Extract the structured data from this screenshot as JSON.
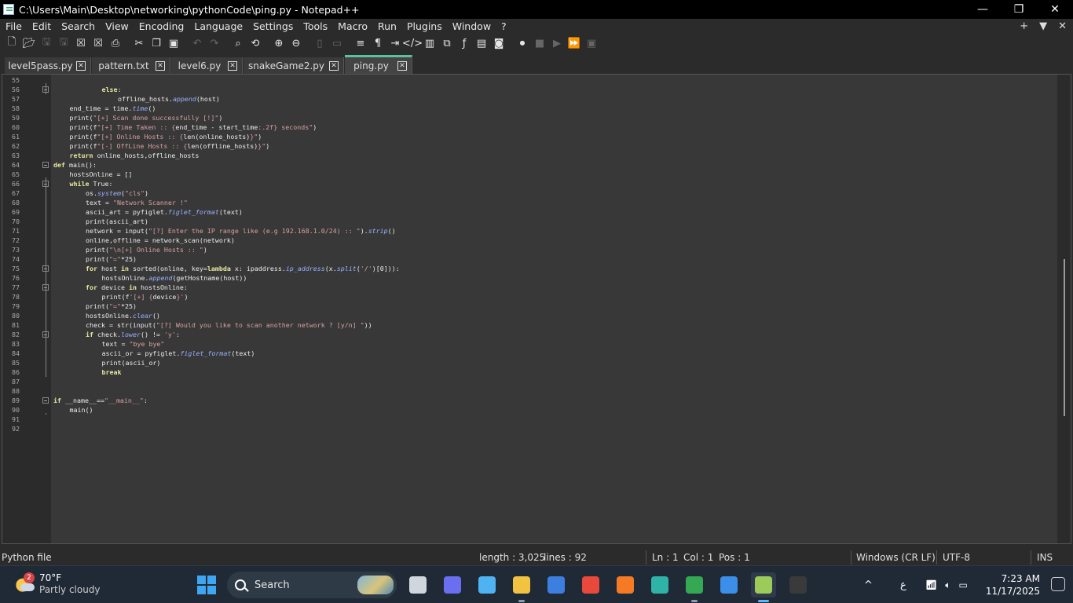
{
  "window": {
    "title": "C:\\Users\\Main\\Desktop\\networking\\pythonCode\\ping.py - Notepad++",
    "controls": [
      "—",
      "❐",
      "✕"
    ]
  },
  "menu": {
    "items": [
      "File",
      "Edit",
      "Search",
      "View",
      "Encoding",
      "Language",
      "Settings",
      "Tools",
      "Macro",
      "Run",
      "Plugins",
      "Window",
      "?"
    ],
    "right": [
      "+",
      "▼",
      "✕"
    ]
  },
  "toolbar": {
    "icons": [
      "new-file-icon",
      "open-file-icon",
      "save-icon",
      "save-all-icon",
      "close-icon",
      "close-all-icon",
      "print-icon",
      "cut-icon",
      "copy-icon",
      "paste-icon",
      "undo-icon",
      "redo-icon",
      "find-icon",
      "replace-icon",
      "zoom-in-icon",
      "zoom-out-icon",
      "sync-vertical-icon",
      "sync-horizontal-icon",
      "word-wrap-icon",
      "show-all-chars-icon",
      "indent-guide-icon",
      "xml-tag-icon",
      "doc-map-icon",
      "doc-list-icon",
      "function-list-icon",
      "folder-workspace-icon",
      "monitor-icon",
      "record-macro-icon",
      "stop-record-icon",
      "play-macro-icon",
      "run-macro-multiple-icon",
      "save-macro-icon"
    ]
  },
  "tabs": [
    {
      "label": "level5pass.py",
      "active": false
    },
    {
      "label": "pattern.txt",
      "active": false
    },
    {
      "label": "level6.py",
      "active": false
    },
    {
      "label": "snakeGame2.py",
      "active": false
    },
    {
      "label": "ping.py",
      "active": true
    }
  ],
  "editor": {
    "lines": [
      {
        "n": "55",
        "indent": 0,
        "tokens": []
      },
      {
        "n": "56",
        "indent": 3,
        "tokens": [
          [
            "kw",
            "else"
          ],
          [
            "plain",
            ":"
          ]
        ]
      },
      {
        "n": "57",
        "indent": 4,
        "tokens": [
          [
            "plain",
            "offline_hosts."
          ],
          [
            "fn",
            "append"
          ],
          [
            "plain",
            "(host)"
          ]
        ]
      },
      {
        "n": "58",
        "indent": 1,
        "tokens": [
          [
            "plain",
            "end_time = time."
          ],
          [
            "fn",
            "time"
          ],
          [
            "plain",
            "()"
          ]
        ]
      },
      {
        "n": "59",
        "indent": 1,
        "tokens": [
          [
            "plain",
            "print("
          ],
          [
            "str",
            "\"[+] Scan done successfully [!]\""
          ],
          [
            "plain",
            ")"
          ]
        ]
      },
      {
        "n": "60",
        "indent": 1,
        "tokens": [
          [
            "plain",
            "print(f"
          ],
          [
            "str",
            "\"[+] Time Taken :: {"
          ],
          [
            "plain",
            "end_time - start_time"
          ],
          [
            "str",
            ":.2f} seconds\""
          ],
          [
            "plain",
            ")"
          ]
        ]
      },
      {
        "n": "61",
        "indent": 1,
        "tokens": [
          [
            "plain",
            "print(f"
          ],
          [
            "str",
            "\"[+] Online Hosts :: {"
          ],
          [
            "plain",
            "len(online_hosts)"
          ],
          [
            "str",
            "}\""
          ],
          [
            "plain",
            ")"
          ]
        ]
      },
      {
        "n": "62",
        "indent": 1,
        "tokens": [
          [
            "plain",
            "print(f"
          ],
          [
            "str",
            "\"[-] OffLine Hosts :: {"
          ],
          [
            "plain",
            "len(offline_hosts)"
          ],
          [
            "str",
            "}\""
          ],
          [
            "plain",
            ")"
          ]
        ]
      },
      {
        "n": "63",
        "indent": 1,
        "tokens": [
          [
            "kw",
            "return"
          ],
          [
            "plain",
            " online_hosts,offline_hosts"
          ]
        ]
      },
      {
        "n": "64",
        "indent": 0,
        "tokens": [
          [
            "kw",
            "def"
          ],
          [
            "plain",
            " main():"
          ]
        ]
      },
      {
        "n": "65",
        "indent": 1,
        "tokens": [
          [
            "plain",
            "hostsOnline = []"
          ]
        ]
      },
      {
        "n": "66",
        "indent": 1,
        "tokens": [
          [
            "kw",
            "while"
          ],
          [
            "plain",
            " True:"
          ]
        ]
      },
      {
        "n": "67",
        "indent": 2,
        "tokens": [
          [
            "plain",
            "os."
          ],
          [
            "fn",
            "system"
          ],
          [
            "plain",
            "("
          ],
          [
            "str",
            "\"cls\""
          ],
          [
            "plain",
            ")"
          ]
        ]
      },
      {
        "n": "68",
        "indent": 2,
        "tokens": [
          [
            "plain",
            "text = "
          ],
          [
            "str",
            "\"Network Scanner !\""
          ]
        ]
      },
      {
        "n": "69",
        "indent": 2,
        "tokens": [
          [
            "plain",
            "ascii_art = pyfiglet."
          ],
          [
            "fn",
            "figlet_format"
          ],
          [
            "plain",
            "(text)"
          ]
        ]
      },
      {
        "n": "70",
        "indent": 2,
        "tokens": [
          [
            "plain",
            "print(ascii_art)"
          ]
        ]
      },
      {
        "n": "71",
        "indent": 2,
        "tokens": [
          [
            "plain",
            "network = input("
          ],
          [
            "str",
            "\"[?] Enter the IP range like (e.g 192.168.1.0/24) :: \""
          ],
          [
            "plain",
            ")."
          ],
          [
            "fn",
            "strip"
          ],
          [
            "plain",
            "()"
          ]
        ]
      },
      {
        "n": "72",
        "indent": 2,
        "tokens": [
          [
            "plain",
            "online,offline = network_scan(network)"
          ]
        ]
      },
      {
        "n": "73",
        "indent": 2,
        "tokens": [
          [
            "plain",
            "print("
          ],
          [
            "str",
            "\"\\n[+] Online Hosts :: \""
          ],
          [
            "plain",
            ")"
          ]
        ]
      },
      {
        "n": "74",
        "indent": 2,
        "tokens": [
          [
            "plain",
            "print("
          ],
          [
            "str",
            "\"=\""
          ],
          [
            "plain",
            "*25)"
          ]
        ]
      },
      {
        "n": "75",
        "indent": 2,
        "tokens": [
          [
            "kw",
            "for"
          ],
          [
            "plain",
            " host "
          ],
          [
            "kw",
            "in"
          ],
          [
            "plain",
            " sorted(online, key="
          ],
          [
            "kw",
            "lambda"
          ],
          [
            "plain",
            " x: ipaddress."
          ],
          [
            "fn",
            "ip_address"
          ],
          [
            "plain",
            "(x."
          ],
          [
            "fn",
            "split"
          ],
          [
            "plain",
            "("
          ],
          [
            "str",
            "'/'"
          ],
          [
            "plain",
            ")[0])):"
          ]
        ]
      },
      {
        "n": "76",
        "indent": 3,
        "tokens": [
          [
            "plain",
            "hostsOnline."
          ],
          [
            "fn",
            "append"
          ],
          [
            "plain",
            "(getHostname(host))"
          ]
        ]
      },
      {
        "n": "77",
        "indent": 2,
        "tokens": [
          [
            "kw",
            "for"
          ],
          [
            "plain",
            " device "
          ],
          [
            "kw",
            "in"
          ],
          [
            "plain",
            " hostsOnline:"
          ]
        ]
      },
      {
        "n": "78",
        "indent": 3,
        "tokens": [
          [
            "plain",
            "print(f"
          ],
          [
            "str",
            "'[+] {"
          ],
          [
            "plain",
            "device"
          ],
          [
            "str",
            "}'"
          ],
          [
            "plain",
            ")"
          ]
        ]
      },
      {
        "n": "79",
        "indent": 2,
        "tokens": [
          [
            "plain",
            "print("
          ],
          [
            "str",
            "\"=\""
          ],
          [
            "plain",
            "*25)"
          ]
        ]
      },
      {
        "n": "80",
        "indent": 2,
        "tokens": [
          [
            "plain",
            "hostsOnline."
          ],
          [
            "fn",
            "clear"
          ],
          [
            "plain",
            "()"
          ]
        ]
      },
      {
        "n": "81",
        "indent": 2,
        "tokens": [
          [
            "plain",
            "check = str(input("
          ],
          [
            "str",
            "\"[?] Would you like to scan another network ? [y/n] \""
          ],
          [
            "plain",
            "))"
          ]
        ]
      },
      {
        "n": "82",
        "indent": 2,
        "tokens": [
          [
            "kw",
            "if"
          ],
          [
            "plain",
            " check."
          ],
          [
            "fn",
            "lower"
          ],
          [
            "plain",
            "() != "
          ],
          [
            "str",
            "'y'"
          ],
          [
            "plain",
            ":"
          ]
        ]
      },
      {
        "n": "83",
        "indent": 3,
        "tokens": [
          [
            "plain",
            "text = "
          ],
          [
            "str",
            "\"bye bye\""
          ]
        ]
      },
      {
        "n": "84",
        "indent": 3,
        "tokens": [
          [
            "plain",
            "ascii_or = pyfiglet."
          ],
          [
            "fn",
            "figlet_format"
          ],
          [
            "plain",
            "(text)"
          ]
        ]
      },
      {
        "n": "85",
        "indent": 3,
        "tokens": [
          [
            "plain",
            "print(ascii_or)"
          ]
        ]
      },
      {
        "n": "86",
        "indent": 3,
        "tokens": [
          [
            "kw",
            "break"
          ]
        ]
      },
      {
        "n": "87",
        "indent": 0,
        "tokens": []
      },
      {
        "n": "88",
        "indent": 0,
        "tokens": []
      },
      {
        "n": "89",
        "indent": 0,
        "tokens": [
          [
            "kw",
            "if"
          ],
          [
            "plain",
            " __name__=="
          ],
          [
            "str",
            "\"__main__\""
          ],
          [
            "plain",
            ":"
          ]
        ]
      },
      {
        "n": "90",
        "indent": 1,
        "tokens": [
          [
            "plain",
            "main()"
          ]
        ]
      },
      {
        "n": "91",
        "indent": 0,
        "tokens": []
      },
      {
        "n": "92",
        "indent": 0,
        "tokens": []
      }
    ],
    "fold_lines": [
      "56",
      "64",
      "66",
      "75",
      "77",
      "82",
      "89"
    ]
  },
  "statusbar": {
    "file_type": "Python file",
    "length": "length : 3,025",
    "lines": "lines : 92",
    "ln": "Ln : 1",
    "col": "Col : 1",
    "pos": "Pos : 1",
    "eol": "Windows (CR LF)",
    "encoding": "UTF-8",
    "mode": "INS"
  },
  "taskbar": {
    "weather_badge": "2",
    "temperature": "70°F",
    "condition": "Partly cloudy",
    "search_placeholder": "Search",
    "apps": [
      {
        "name": "task-view-icon",
        "color": "#d0d6de",
        "active": false
      },
      {
        "name": "teams-chat-icon",
        "color": "#6a6ff0",
        "active": false
      },
      {
        "name": "copilot-icon",
        "color": "#4fb3f2",
        "active": false
      },
      {
        "name": "file-explorer-icon",
        "color": "#f2c241",
        "active": false
      },
      {
        "name": "store-icon",
        "color": "#3c7fe0",
        "active": false
      },
      {
        "name": "chrome-icon",
        "color": "#e9493a",
        "active": false
      },
      {
        "name": "firefox-icon",
        "color": "#f47b24",
        "active": false
      },
      {
        "name": "edge-icon",
        "color": "#2fb3a6",
        "active": false
      },
      {
        "name": "chrome-profile-icon",
        "color": "#34a853",
        "active": false
      },
      {
        "name": "photos-icon",
        "color": "#3b8fe8",
        "active": false
      },
      {
        "name": "notepadpp-icon",
        "color": "#9ccb5a",
        "active": true
      },
      {
        "name": "terminal-icon",
        "color": "#3a3a3a",
        "active": false
      }
    ],
    "tray": {
      "chevron": "^",
      "language": "ع",
      "time": "7:23 AM",
      "date": "11/17/2025"
    }
  },
  "colors": {
    "active_tab_accent": "#5fc0a0",
    "keyword": "#e8e8a0",
    "function": "#9ab0ff",
    "string": "#d9a0a0"
  }
}
